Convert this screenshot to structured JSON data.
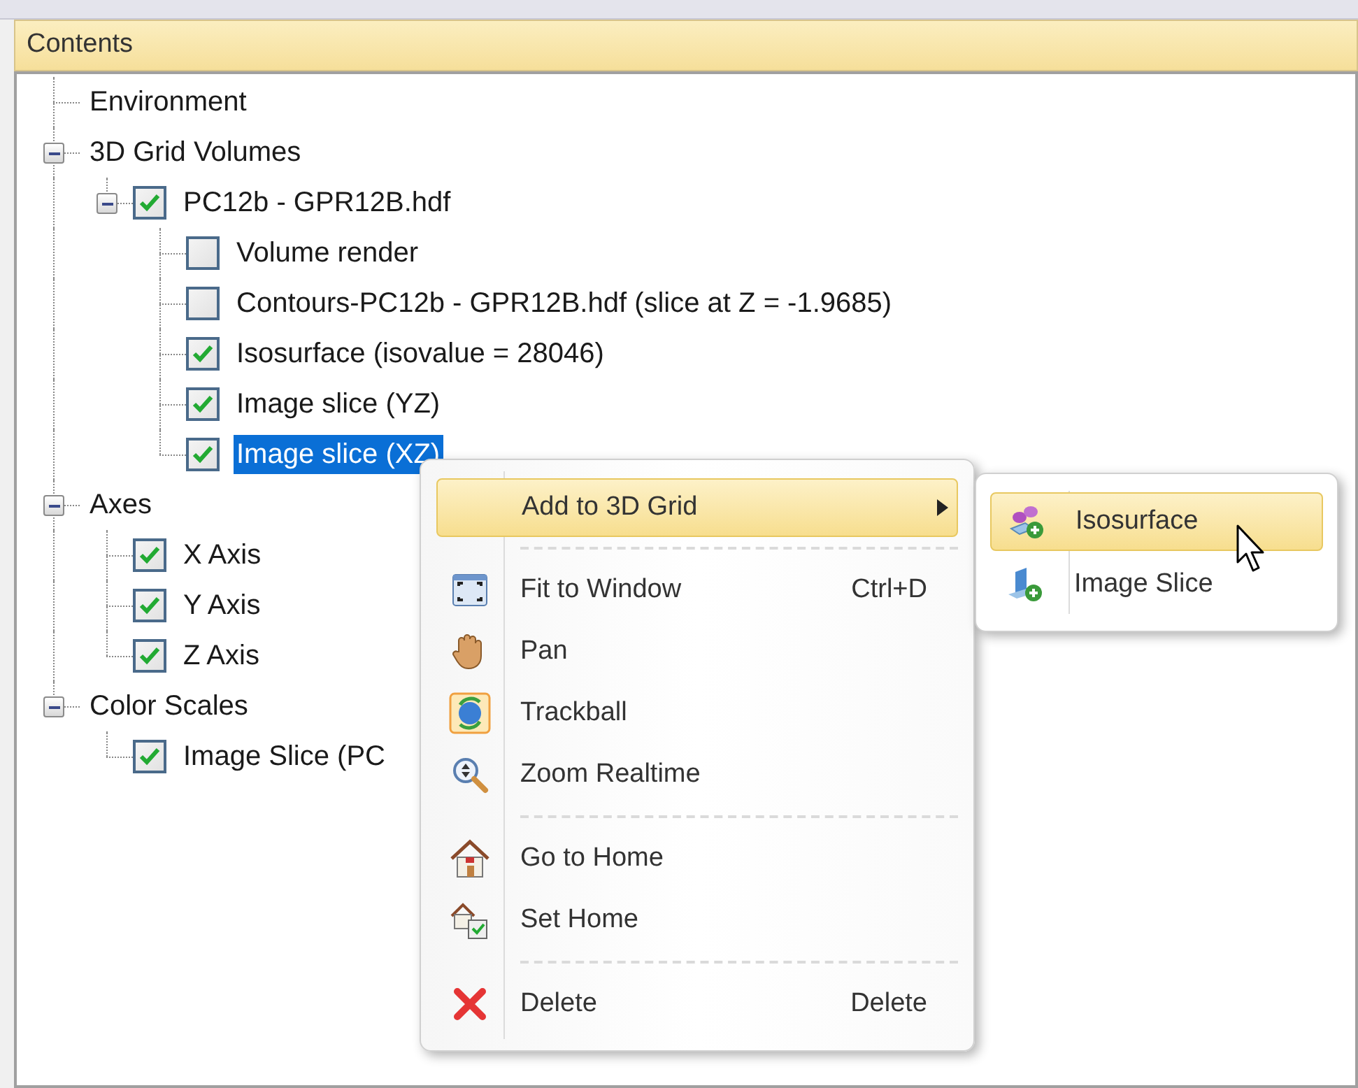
{
  "panel": {
    "title": "Contents"
  },
  "tree": [
    {
      "label": "Environment",
      "selected": false
    },
    {
      "label": "3D Grid Volumes",
      "expanded": true,
      "selected": false,
      "children": [
        {
          "label": "PC12b - GPR12B.hdf",
          "checked": true,
          "expanded": true,
          "selected": false,
          "children": [
            {
              "label": "Volume render",
              "checked": false,
              "selected": false
            },
            {
              "label": "Contours-PC12b - GPR12B.hdf (slice at Z = -1.9685)",
              "checked": false,
              "selected": false
            },
            {
              "label": "Isosurface (isovalue = 28046)",
              "checked": true,
              "selected": false
            },
            {
              "label": "Image slice (YZ)",
              "checked": true,
              "selected": false
            },
            {
              "label": "Image slice (XZ)",
              "checked": true,
              "selected": true
            }
          ]
        }
      ]
    },
    {
      "label": "Axes",
      "expanded": true,
      "selected": false,
      "children": [
        {
          "label": "X Axis",
          "checked": true,
          "selected": false
        },
        {
          "label": "Y Axis",
          "checked": true,
          "selected": false
        },
        {
          "label": "Z Axis",
          "checked": true,
          "selected": false
        }
      ]
    },
    {
      "label": "Color Scales",
      "expanded": true,
      "selected": false,
      "children": [
        {
          "label": "Image Slice (PC",
          "checked": true,
          "selected": false
        }
      ]
    }
  ],
  "context_menu": [
    {
      "kind": "submenu",
      "label": "Add to 3D Grid",
      "selected": true
    },
    {
      "kind": "separator"
    },
    {
      "kind": "item",
      "label": "Fit to Window",
      "shortcut": "Ctrl+D",
      "selected": false,
      "checked": false
    },
    {
      "kind": "item",
      "label": "Pan",
      "selected": false,
      "checked": false
    },
    {
      "kind": "item",
      "label": "Trackball",
      "selected": false,
      "checked": true
    },
    {
      "kind": "item",
      "label": "Zoom Realtime",
      "selected": false,
      "checked": false
    },
    {
      "kind": "separator"
    },
    {
      "kind": "item",
      "label": "Go to Home",
      "selected": false,
      "checked": false
    },
    {
      "kind": "item",
      "label": "Set Home",
      "selected": false,
      "checked": false
    },
    {
      "kind": "separator"
    },
    {
      "kind": "item",
      "label": "Delete",
      "shortcut": "Delete",
      "selected": false,
      "checked": false
    }
  ],
  "submenu": [
    {
      "label": "Isosurface",
      "selected": true
    },
    {
      "label": "Image Slice",
      "selected": false
    }
  ]
}
